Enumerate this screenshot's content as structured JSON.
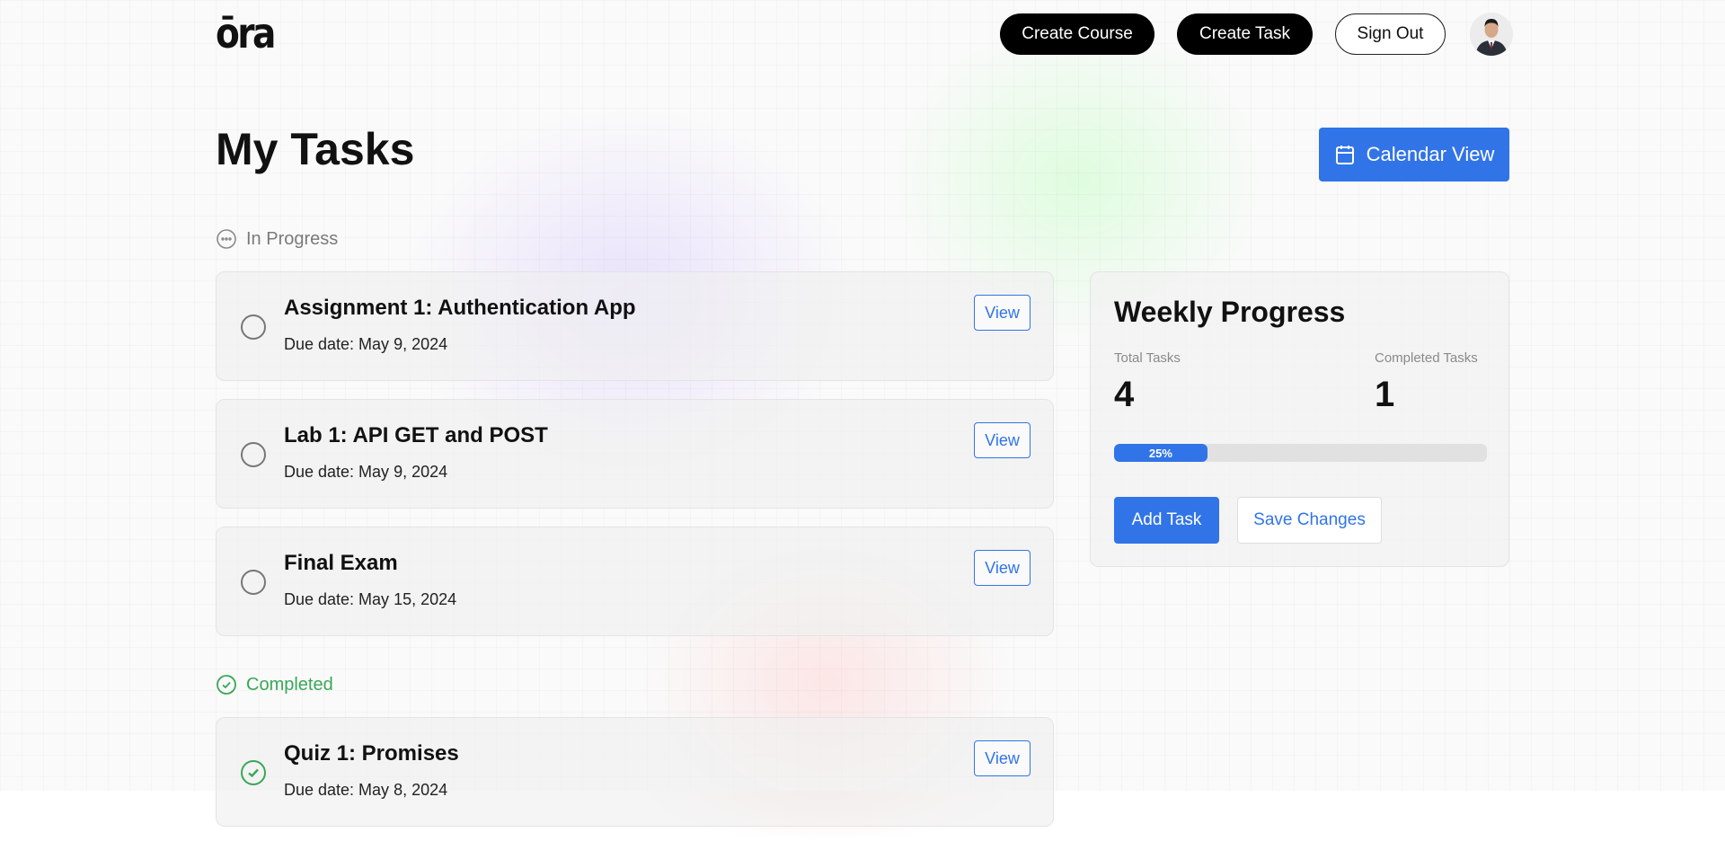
{
  "header": {
    "logo_text": "ōra",
    "buttons": {
      "create_course": "Create Course",
      "create_task": "Create Task",
      "sign_out": "Sign Out"
    }
  },
  "main": {
    "title": "My Tasks",
    "calendar_button": "Calendar View",
    "in_progress": {
      "label": "In Progress",
      "tasks": [
        {
          "title": "Assignment 1: Authentication App",
          "due": "Due date: May 9, 2024",
          "action": "View"
        },
        {
          "title": "Lab 1: API GET and POST",
          "due": "Due date: May 9, 2024",
          "action": "View"
        },
        {
          "title": "Final Exam",
          "due": "Due date: May 15, 2024",
          "action": "View"
        }
      ]
    },
    "completed": {
      "label": "Completed",
      "tasks": [
        {
          "title": "Quiz 1: Promises",
          "due": "Due date: May 8, 2024",
          "action": "View"
        }
      ]
    }
  },
  "weekly_progress": {
    "title": "Weekly Progress",
    "total_label": "Total Tasks",
    "total_value": "4",
    "completed_label": "Completed Tasks",
    "completed_value": "1",
    "progress_text": "25%",
    "progress_fraction": 0.25,
    "add_button": "Add Task",
    "save_button": "Save Changes"
  },
  "colors": {
    "accent": "#3174e8",
    "completed": "#3aa757",
    "dark_button": "#000000"
  },
  "icons": {
    "calendar": "calendar-icon",
    "in_progress": "ellipsis-circle-icon",
    "completed": "check-circle-icon",
    "avatar": "user-avatar"
  }
}
